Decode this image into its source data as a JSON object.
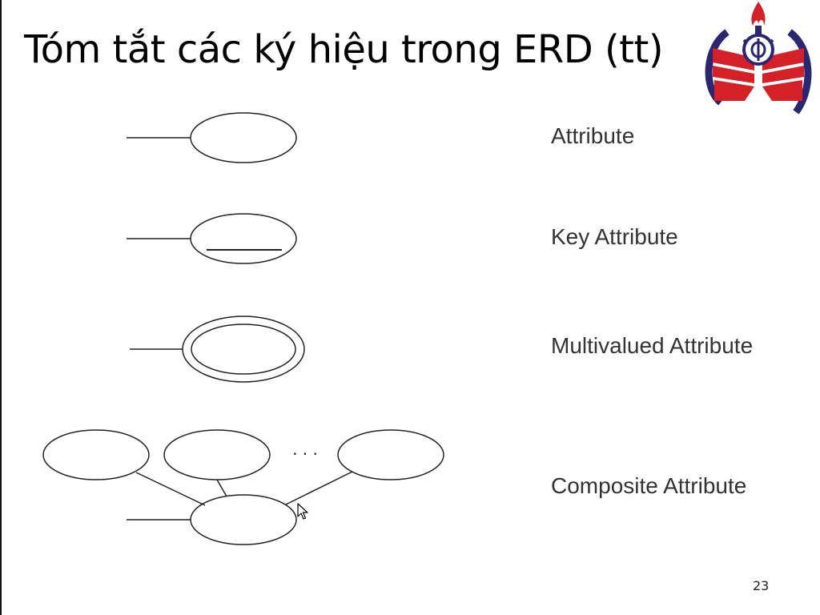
{
  "slide": {
    "title": "Tóm tắt các ký hiệu trong ERD (tt)",
    "page_number": "23"
  },
  "legend": {
    "attribute": "Attribute",
    "key_attribute": "Key Attribute",
    "multivalued_attribute": "Multivalued Attribute",
    "composite_attribute": "Composite Attribute",
    "ellipsis": "· · ·"
  },
  "colors": {
    "logo_red": "#d42027",
    "logo_navy": "#2a2670",
    "stroke": "#222222",
    "label_text": "#333333"
  },
  "icons": {
    "logo": "university-logo-icon",
    "cursor": "mouse-pointer-icon"
  }
}
